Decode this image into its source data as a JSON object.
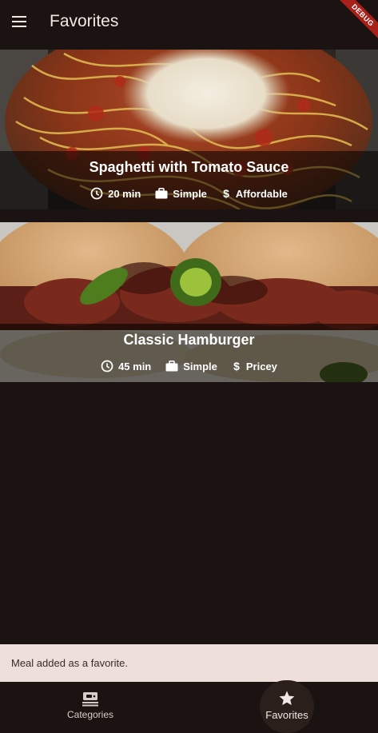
{
  "appbar": {
    "title": "Favorites",
    "menu_icon": "menu-icon",
    "debug_label": "DEBUG"
  },
  "meals": [
    {
      "title": "Spaghetti with Tomato Sauce",
      "duration": "20 min",
      "complexity": "Simple",
      "affordability": "Affordable"
    },
    {
      "title": "Classic Hamburger",
      "duration": "45 min",
      "complexity": "Simple",
      "affordability": "Pricey"
    }
  ],
  "snackbar": {
    "message": "Meal added as a favorite."
  },
  "bottom_nav": {
    "items": [
      {
        "label": "Categories",
        "icon": "set-meal-icon"
      },
      {
        "label": "Favorites",
        "icon": "star-icon"
      }
    ],
    "selected": "Favorites"
  },
  "colors": {
    "background": "#1b1311",
    "snackbar_bg": "#efdfdb",
    "debug_ribbon": "#a8201a"
  }
}
